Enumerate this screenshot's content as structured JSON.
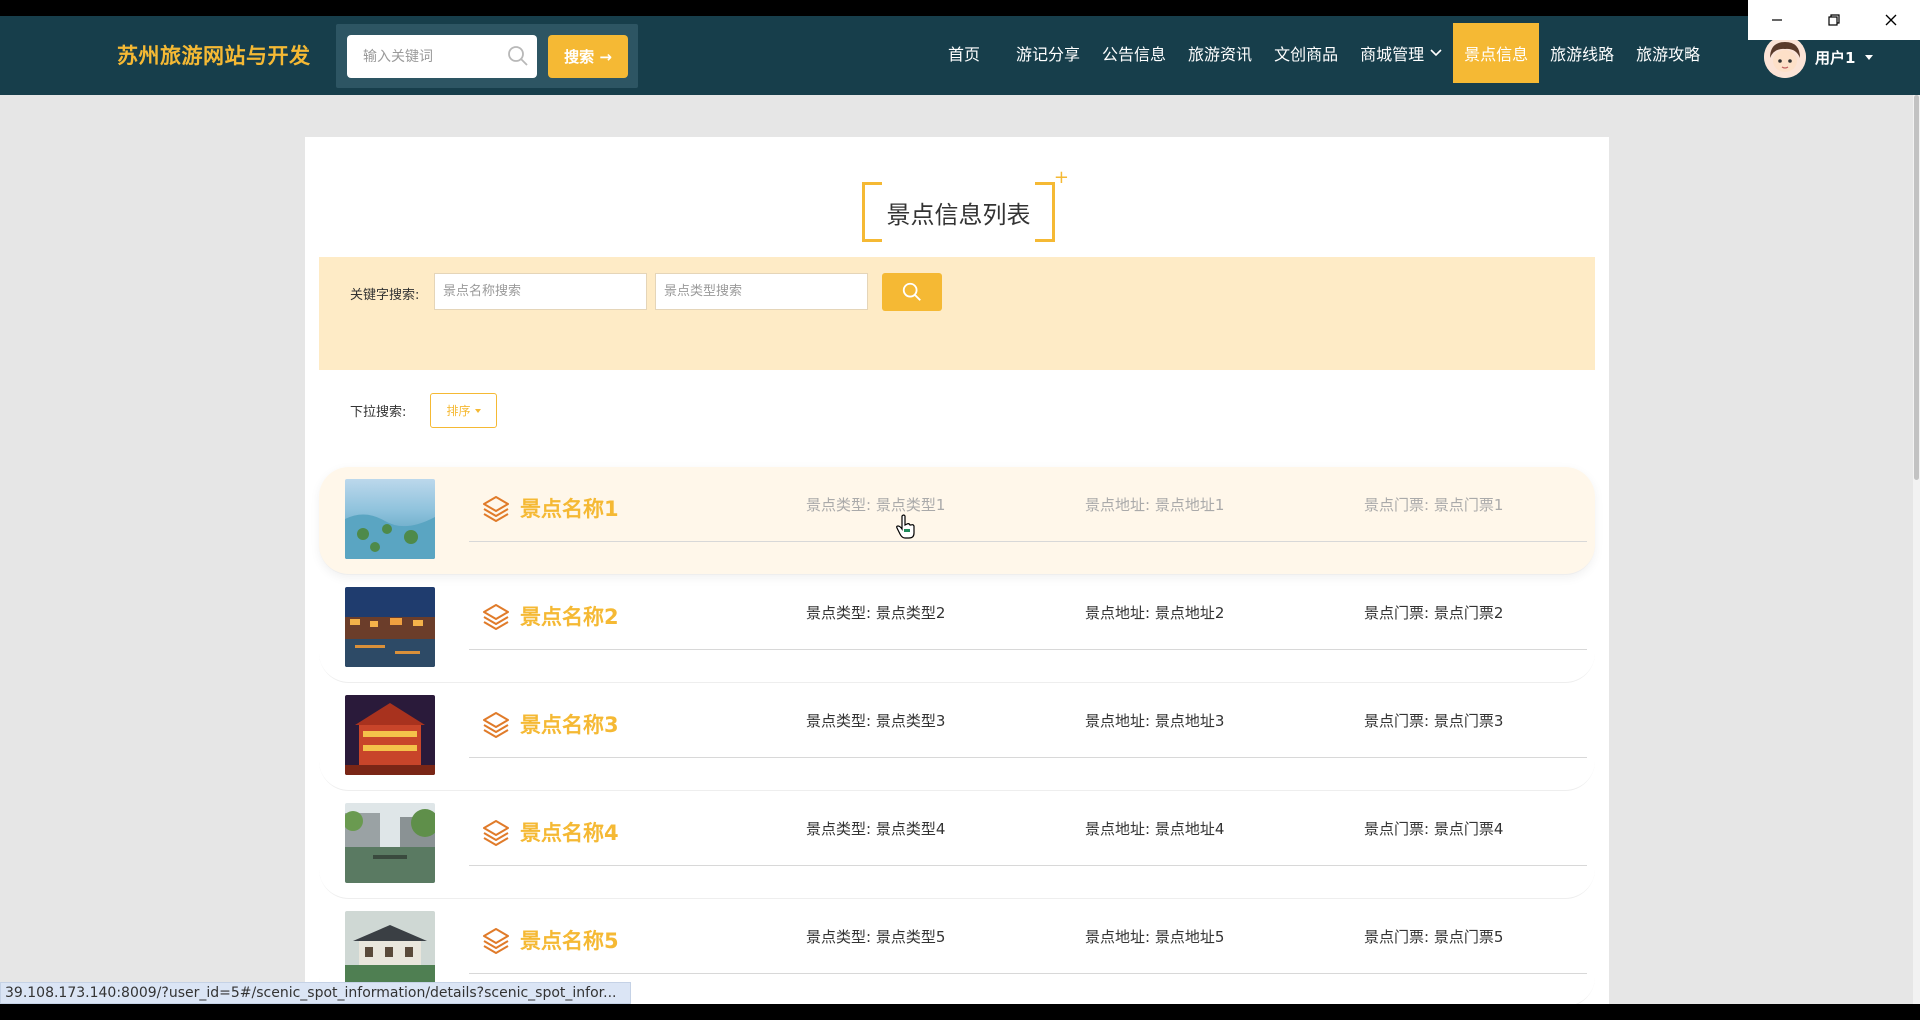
{
  "nav": {
    "brand": "苏州旅游网站与开发",
    "search_placeholder": "输入关键词",
    "search_button": "搜索 →",
    "links": [
      "首页",
      "游记分享",
      "公告信息",
      "旅游资讯",
      "文创商品",
      "商城管理",
      "景点信息",
      "旅游线路",
      "旅游攻略"
    ],
    "active_index": 6,
    "user_name": "用户1"
  },
  "page": {
    "title": "景点信息列表",
    "keyword_label": "关键字搜索:",
    "name_placeholder": "景点名称搜索",
    "type_placeholder": "景点类型搜索",
    "dropdown_label": "下拉搜索:",
    "sort_label": "排序"
  },
  "spots": [
    {
      "name": "景点名称1",
      "type": "景点类型:  景点类型1",
      "address": "景点地址:  景点地址1",
      "ticket": "景点门票:  景点门票1"
    },
    {
      "name": "景点名称2",
      "type": "景点类型:  景点类型2",
      "address": "景点地址:  景点地址2",
      "ticket": "景点门票:  景点门票2"
    },
    {
      "name": "景点名称3",
      "type": "景点类型:  景点类型3",
      "address": "景点地址:  景点地址3",
      "ticket": "景点门票:  景点门票3"
    },
    {
      "name": "景点名称4",
      "type": "景点类型:  景点类型4",
      "address": "景点地址:  景点地址4",
      "ticket": "景点门票:  景点门票4"
    },
    {
      "name": "景点名称5",
      "type": "景点类型:  景点类型5",
      "address": "景点地址:  景点地址5",
      "ticket": "景点门票:  景点门票5"
    }
  ],
  "status_url": "39.108.173.140:8009/?user_id=5#/scenic_spot_information/details?scenic_spot_infor...",
  "colors": {
    "accent": "#f5b934",
    "navbar": "#173e4b",
    "search_band": "#feebc6"
  }
}
